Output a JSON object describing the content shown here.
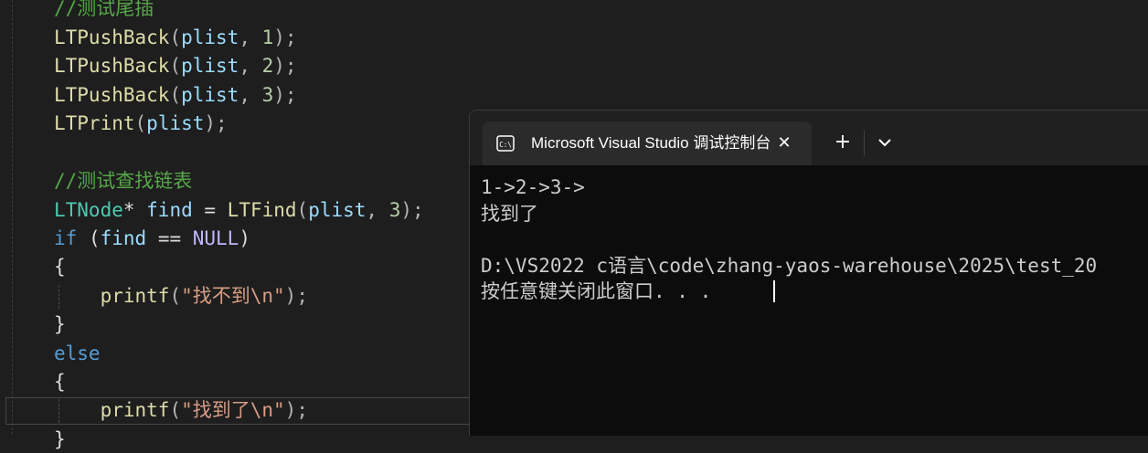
{
  "editor": {
    "lines": [
      {
        "parts": [
          {
            "t": "//测试尾插",
            "c": "comment"
          }
        ]
      },
      {
        "parts": [
          {
            "t": "LTPushBack",
            "c": "func"
          },
          {
            "t": "(",
            "c": "punc"
          },
          {
            "t": "plist",
            "c": "var"
          },
          {
            "t": ", ",
            "c": "punc"
          },
          {
            "t": "1",
            "c": "num"
          },
          {
            "t": ");",
            "c": "punc"
          }
        ]
      },
      {
        "parts": [
          {
            "t": "LTPushBack",
            "c": "func"
          },
          {
            "t": "(",
            "c": "punc"
          },
          {
            "t": "plist",
            "c": "var"
          },
          {
            "t": ", ",
            "c": "punc"
          },
          {
            "t": "2",
            "c": "num"
          },
          {
            "t": ");",
            "c": "punc"
          }
        ]
      },
      {
        "parts": [
          {
            "t": "LTPushBack",
            "c": "func"
          },
          {
            "t": "(",
            "c": "punc"
          },
          {
            "t": "plist",
            "c": "var"
          },
          {
            "t": ", ",
            "c": "punc"
          },
          {
            "t": "3",
            "c": "num"
          },
          {
            "t": ");",
            "c": "punc"
          }
        ]
      },
      {
        "parts": [
          {
            "t": "LTPrint",
            "c": "func"
          },
          {
            "t": "(",
            "c": "punc"
          },
          {
            "t": "plist",
            "c": "var"
          },
          {
            "t": ");",
            "c": "punc"
          }
        ]
      },
      {
        "parts": []
      },
      {
        "parts": [
          {
            "t": "//测试查找链表",
            "c": "comment"
          }
        ]
      },
      {
        "parts": [
          {
            "t": "LTNode",
            "c": "type"
          },
          {
            "t": "* ",
            "c": "plain"
          },
          {
            "t": "find",
            "c": "var"
          },
          {
            "t": " = ",
            "c": "plain"
          },
          {
            "t": "LTFind",
            "c": "func"
          },
          {
            "t": "(",
            "c": "punc"
          },
          {
            "t": "plist",
            "c": "var"
          },
          {
            "t": ", ",
            "c": "punc"
          },
          {
            "t": "3",
            "c": "num"
          },
          {
            "t": ");",
            "c": "punc"
          }
        ]
      },
      {
        "parts": [
          {
            "t": "if",
            "c": "kw"
          },
          {
            "t": " (",
            "c": "plain"
          },
          {
            "t": "find",
            "c": "var"
          },
          {
            "t": " == ",
            "c": "plain"
          },
          {
            "t": "NULL",
            "c": "macro"
          },
          {
            "t": ")",
            "c": "plain"
          }
        ]
      },
      {
        "parts": [
          {
            "t": "{",
            "c": "plain"
          }
        ]
      },
      {
        "parts": [
          {
            "t": "    ",
            "c": "plain"
          },
          {
            "t": "printf",
            "c": "func"
          },
          {
            "t": "(",
            "c": "punc"
          },
          {
            "t": "\"找不到\\n\"",
            "c": "str"
          },
          {
            "t": ");",
            "c": "punc"
          }
        ]
      },
      {
        "parts": [
          {
            "t": "}",
            "c": "plain"
          }
        ]
      },
      {
        "parts": [
          {
            "t": "else",
            "c": "kw"
          }
        ]
      },
      {
        "parts": [
          {
            "t": "{",
            "c": "plain"
          }
        ]
      },
      {
        "parts": [
          {
            "t": "    ",
            "c": "plain"
          },
          {
            "t": "printf",
            "c": "func"
          },
          {
            "t": "(",
            "c": "punc"
          },
          {
            "t": "\"找到了\\n\"",
            "c": "str"
          },
          {
            "t": ");",
            "c": "punc"
          }
        ]
      },
      {
        "parts": [
          {
            "t": "}",
            "c": "plain"
          }
        ]
      }
    ]
  },
  "terminal": {
    "tab_title": "Microsoft Visual Studio 调试控制台",
    "tab_icon": "console-icon",
    "close_icon": "close-icon",
    "new_tab_label": "+",
    "dropdown_icon": "chevron-down-icon",
    "output": [
      "1->2->3->",
      "找到了",
      "",
      "D:\\VS2022 c语言\\code\\zhang-yaos-warehouse\\2025\\test_20",
      "按任意键关闭此窗口. . ."
    ]
  },
  "colors": {
    "comment": "#57a64a",
    "func": "#dcdcaa",
    "var": "#9cdcfe",
    "num": "#b5cea8",
    "type": "#4ec9b0",
    "kw": "#569cd6",
    "str": "#d69d85",
    "macro": "#beb7ff"
  }
}
